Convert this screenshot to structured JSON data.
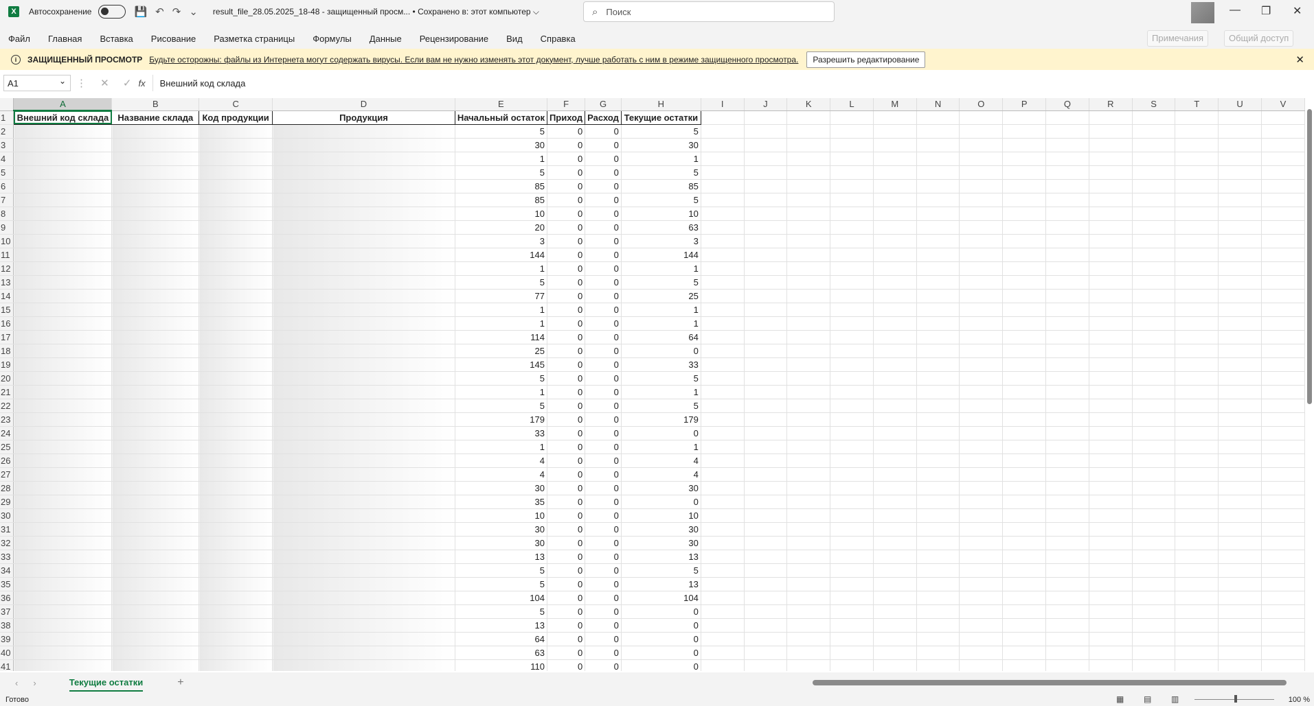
{
  "titlebar": {
    "app_icon": "excel-icon",
    "autosave_label": "Автосохранение",
    "doc_title": "result_file_28.05.2025_18-48  -  защищенный просм...  •  Сохранено в: этот компьютер ⌵",
    "search_placeholder": "Поиск"
  },
  "menu": [
    "Файл",
    "Главная",
    "Вставка",
    "Рисование",
    "Разметка страницы",
    "Формулы",
    "Данные",
    "Рецензирование",
    "Вид",
    "Справка"
  ],
  "ribbon_right": {
    "comments": "Примечания",
    "share": "Общий доступ"
  },
  "protected_view": {
    "title": "ЗАЩИЩЕННЫЙ ПРОСМОТР",
    "message": "Будьте осторожны: файлы из Интернета могут содержать вирусы. Если вам не нужно изменять этот документ, лучше работать с ним в режиме защищенного просмотра.",
    "button": "Разрешить редактирование"
  },
  "formula_bar": {
    "name_box": "A1",
    "fx": "fx",
    "content": "Внешний код склада"
  },
  "columns": [
    "A",
    "B",
    "C",
    "D",
    "E",
    "F",
    "G",
    "H",
    "I",
    "J",
    "K",
    "L",
    "M",
    "N",
    "O",
    "P",
    "Q",
    "R",
    "S",
    "T",
    "U",
    "V"
  ],
  "headers": [
    "Внешний код склада",
    "Название склада",
    "Код продукции",
    "Продукция",
    "Начальный остаток",
    "Приход",
    "Расход",
    "Текущие остатки"
  ],
  "rows": [
    [
      5,
      0,
      0,
      5
    ],
    [
      30,
      0,
      0,
      30
    ],
    [
      1,
      0,
      0,
      1
    ],
    [
      5,
      0,
      0,
      5
    ],
    [
      85,
      0,
      0,
      85
    ],
    [
      85,
      0,
      0,
      5
    ],
    [
      10,
      0,
      0,
      10
    ],
    [
      20,
      0,
      0,
      63
    ],
    [
      3,
      0,
      0,
      3
    ],
    [
      144,
      0,
      0,
      144
    ],
    [
      1,
      0,
      0,
      1
    ],
    [
      5,
      0,
      0,
      5
    ],
    [
      77,
      0,
      0,
      25
    ],
    [
      1,
      0,
      0,
      1
    ],
    [
      1,
      0,
      0,
      1
    ],
    [
      114,
      0,
      0,
      64
    ],
    [
      25,
      0,
      0,
      0
    ],
    [
      145,
      0,
      0,
      33
    ],
    [
      5,
      0,
      0,
      5
    ],
    [
      1,
      0,
      0,
      1
    ],
    [
      5,
      0,
      0,
      5
    ],
    [
      179,
      0,
      0,
      179
    ],
    [
      33,
      0,
      0,
      0
    ],
    [
      1,
      0,
      0,
      1
    ],
    [
      4,
      0,
      0,
      4
    ],
    [
      4,
      0,
      0,
      4
    ],
    [
      30,
      0,
      0,
      30
    ],
    [
      35,
      0,
      0,
      0
    ],
    [
      10,
      0,
      0,
      10
    ],
    [
      30,
      0,
      0,
      30
    ],
    [
      30,
      0,
      0,
      30
    ],
    [
      13,
      0,
      0,
      13
    ],
    [
      5,
      0,
      0,
      5
    ],
    [
      5,
      0,
      0,
      13
    ],
    [
      104,
      0,
      0,
      104
    ],
    [
      5,
      0,
      0,
      0
    ],
    [
      13,
      0,
      0,
      0
    ],
    [
      64,
      0,
      0,
      0
    ],
    [
      63,
      0,
      0,
      0
    ],
    [
      110,
      0,
      0,
      0
    ]
  ],
  "sheet_tab": "Текущие остатки",
  "status": {
    "ready": "Готово",
    "zoom": "100 %"
  }
}
